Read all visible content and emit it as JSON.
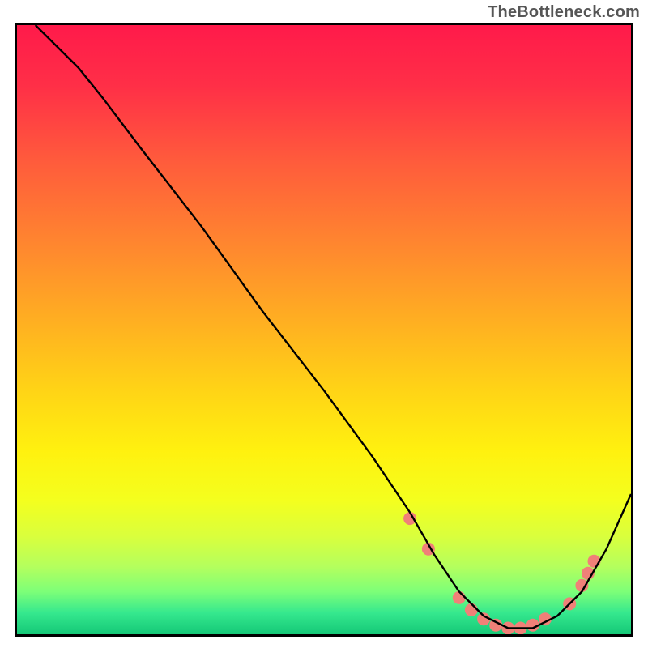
{
  "attribution": "TheBottleneck.com",
  "chart_data": {
    "type": "line",
    "title": "",
    "xlabel": "",
    "ylabel": "",
    "xlim": [
      0,
      100
    ],
    "ylim": [
      0,
      100
    ],
    "background": {
      "type": "vertical-gradient",
      "stops": [
        {
          "offset": 0.0,
          "color": "#ff1a4a"
        },
        {
          "offset": 0.1,
          "color": "#ff2f47"
        },
        {
          "offset": 0.22,
          "color": "#ff5a3c"
        },
        {
          "offset": 0.35,
          "color": "#ff8330"
        },
        {
          "offset": 0.48,
          "color": "#ffad22"
        },
        {
          "offset": 0.6,
          "color": "#ffd416"
        },
        {
          "offset": 0.7,
          "color": "#fff10f"
        },
        {
          "offset": 0.78,
          "color": "#f4ff1e"
        },
        {
          "offset": 0.84,
          "color": "#d9ff3d"
        },
        {
          "offset": 0.89,
          "color": "#b3ff5e"
        },
        {
          "offset": 0.93,
          "color": "#7dff78"
        },
        {
          "offset": 0.965,
          "color": "#35e88e"
        },
        {
          "offset": 1.0,
          "color": "#15c877"
        }
      ]
    },
    "series": [
      {
        "name": "bottleneck-curve",
        "color": "#000000",
        "x": [
          3,
          6,
          10,
          14,
          20,
          30,
          40,
          50,
          58,
          64,
          68,
          72,
          76,
          80,
          84,
          88,
          92,
          96,
          100
        ],
        "y": [
          100,
          97,
          93,
          88,
          80,
          67,
          53,
          40,
          29,
          20,
          13,
          7,
          3,
          1,
          1,
          3,
          7,
          14,
          23
        ]
      }
    ],
    "markers": {
      "name": "highlight-dots",
      "color": "#f08078",
      "radius": 8,
      "points": [
        {
          "x": 64,
          "y": 19
        },
        {
          "x": 67,
          "y": 14
        },
        {
          "x": 72,
          "y": 6
        },
        {
          "x": 74,
          "y": 4
        },
        {
          "x": 76,
          "y": 2.5
        },
        {
          "x": 78,
          "y": 1.5
        },
        {
          "x": 80,
          "y": 1
        },
        {
          "x": 82,
          "y": 1
        },
        {
          "x": 84,
          "y": 1.5
        },
        {
          "x": 86,
          "y": 2.5
        },
        {
          "x": 90,
          "y": 5
        },
        {
          "x": 92,
          "y": 8
        },
        {
          "x": 93,
          "y": 10
        },
        {
          "x": 94,
          "y": 12
        }
      ]
    }
  }
}
